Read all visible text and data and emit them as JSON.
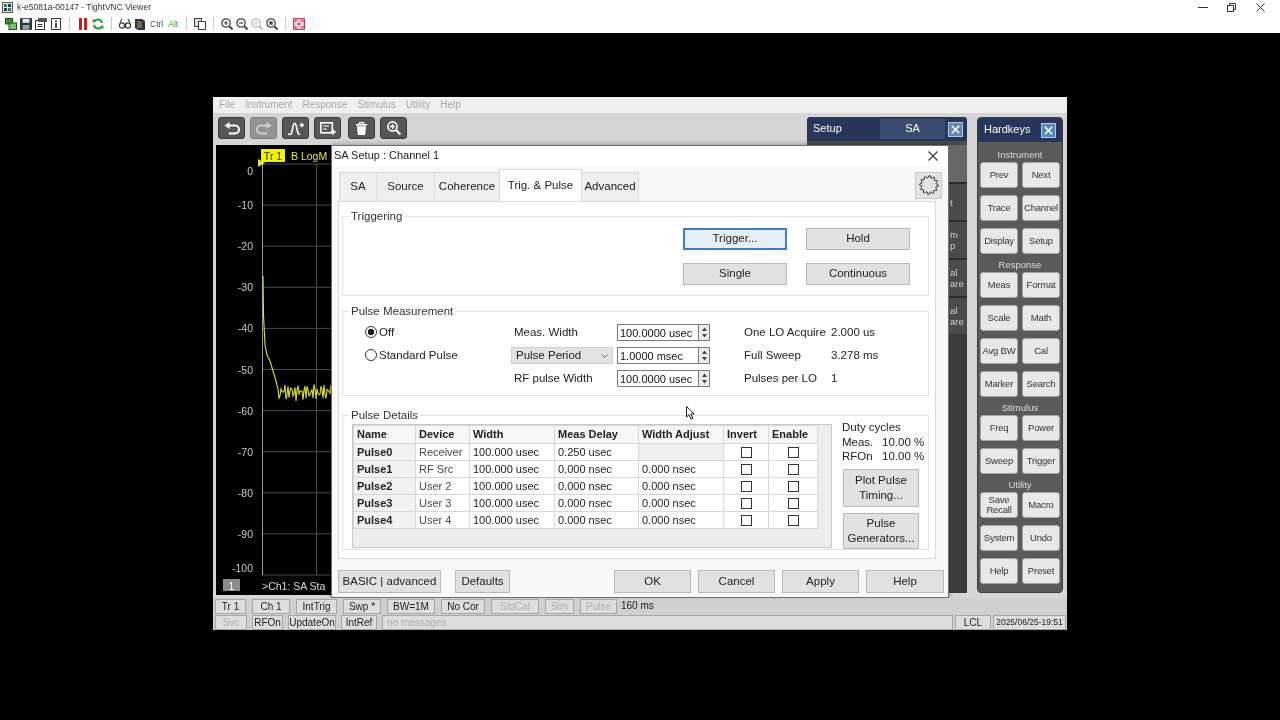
{
  "vnc_window": {
    "title": "k-e5081a-00147 - TightVNC Viewer",
    "toolbar": [
      {
        "kind": "icon",
        "disabled": false
      },
      {
        "kind": "icon",
        "disabled": false
      },
      {
        "kind": "icon",
        "disabled": false
      },
      {
        "kind": "icon",
        "disabled": false
      },
      {
        "kind": "separator"
      },
      {
        "kind": "icon",
        "disabled": false
      },
      {
        "kind": "icon",
        "disabled": false
      },
      {
        "kind": "separator"
      },
      {
        "kind": "icon",
        "disabled": false
      },
      {
        "kind": "icon",
        "disabled": false
      },
      {
        "kind": "key",
        "label": "Ctrl"
      },
      {
        "kind": "key",
        "label": "Alt"
      },
      {
        "kind": "separator"
      },
      {
        "kind": "icon",
        "disabled": false
      },
      {
        "kind": "separator"
      },
      {
        "kind": "icon",
        "disabled": false
      },
      {
        "kind": "icon",
        "disabled": false
      },
      {
        "kind": "icon",
        "disabled": true
      },
      {
        "kind": "icon",
        "disabled": false
      },
      {
        "kind": "separator"
      },
      {
        "kind": "icon",
        "disabled": false
      }
    ]
  },
  "instrument": {
    "menu": [
      {
        "label": "File",
        "disabled": true
      },
      {
        "label": "Instrument",
        "disabled": true
      },
      {
        "label": "Response",
        "disabled": true
      },
      {
        "label": "Stimulus",
        "disabled": true
      },
      {
        "label": "Utility",
        "disabled": true
      },
      {
        "label": "Help",
        "disabled": true
      }
    ],
    "toolbar": [
      {
        "disabled": false
      },
      {
        "disabled": true
      },
      {
        "disabled": false
      },
      {
        "disabled": false
      },
      {
        "disabled": false
      },
      {
        "disabled": false
      }
    ],
    "trace_window": {
      "trace_label": "Tr 1",
      "format": "B LogM",
      "y_axis_labels": [
        "0",
        "-10",
        "-20",
        "-30",
        "-40",
        "-50",
        "-60",
        "-70",
        "-80",
        "-90",
        "-100"
      ],
      "channel_number": "1",
      "channel_status": ">Ch1: SA Sta"
    },
    "setup_panel": {
      "title": "Setup",
      "tab": "SA",
      "softkeys": [
        {
          "lines": [
            "t"
          ]
        },
        {
          "lines": [
            "m",
            "p"
          ]
        },
        {
          "lines": [
            "al",
            "are"
          ]
        },
        {
          "lines": [
            "al",
            "are"
          ]
        }
      ]
    },
    "hardkeys": {
      "title": "Hardkeys",
      "sections": [
        {
          "label": "Instrument",
          "keys": [
            "Prev",
            "Next",
            "Trace",
            "Channel",
            "Display",
            "Setup"
          ]
        },
        {
          "label": "Response",
          "keys": [
            "Meas",
            "Format",
            "Scale",
            "Math",
            "Avg BW",
            "Cal",
            "Marker",
            "Search"
          ]
        },
        {
          "label": "Stimulus",
          "keys": [
            "Freq",
            "Power",
            "Sweep",
            "Trigger"
          ]
        },
        {
          "label": "Utility",
          "keys": [
            "Save Recall",
            "Macro",
            "System",
            "Undo",
            "Help",
            "Preset"
          ]
        }
      ]
    },
    "status_bar": {
      "row_1": [
        {
          "label": "Tr 1",
          "active": true
        },
        {
          "label": "Ch 1",
          "active": true
        },
        {
          "label": "IntTrig",
          "active": true
        },
        {
          "label": "Swp *",
          "active": true
        },
        {
          "label": "BW=1M",
          "active": true
        },
        {
          "label": "No Cor",
          "active": true
        },
        {
          "label": "StdCal",
          "active": false
        },
        {
          "label": "Sim",
          "active": false
        },
        {
          "label": "Pulse",
          "active": false
        }
      ],
      "sweep_time": "160 ms",
      "row_2": [
        {
          "label": "Svc",
          "active": false
        },
        {
          "label": "RFOn",
          "active": true
        },
        {
          "label": "UpdateOn",
          "active": true
        },
        {
          "label": "IntRef",
          "active": true
        }
      ],
      "message": "no messages",
      "indicators": [
        "LCL",
        "2025/06/25-19:51"
      ]
    }
  },
  "dialog": {
    "title": "SA Setup : Channel 1",
    "tabs": [
      {
        "label": "SA",
        "selected": false
      },
      {
        "label": "Source",
        "selected": false
      },
      {
        "label": "Coherence",
        "selected": false
      },
      {
        "label": "Trig. & Pulse",
        "selected": true
      },
      {
        "label": "Advanced",
        "selected": false
      }
    ],
    "triggering": {
      "title": "Triggering",
      "buttons": [
        {
          "label": "Trigger...",
          "focused": true
        },
        {
          "label": "Hold",
          "focused": false
        },
        {
          "label": "Single",
          "focused": false
        },
        {
          "label": "Continuous",
          "focused": false
        }
      ]
    },
    "pulse_measurement": {
      "title": "Pulse Measurement",
      "modes": [
        {
          "label": "Off",
          "selected": true
        },
        {
          "label": "Standard Pulse",
          "selected": false
        }
      ],
      "fields": [
        {
          "kind": "label",
          "label": "Meas. Width",
          "value": "100.0000 usec"
        },
        {
          "kind": "dropdown",
          "label": "Pulse Period",
          "value": "1.0000 msec"
        },
        {
          "kind": "label",
          "label": "RF pulse Width",
          "value": "100.0000 usec"
        }
      ],
      "readouts": [
        {
          "label": "One LO Acquire",
          "value": "2.000 us"
        },
        {
          "label": "Full Sweep",
          "value": "3.278 ms"
        },
        {
          "label": "Pulses per LO",
          "value": "1"
        }
      ]
    },
    "pulse_details": {
      "title": "Pulse Details",
      "columns": [
        "Name",
        "Device",
        "Width",
        "Meas Delay",
        "Width Adjust",
        "Invert",
        "Enable"
      ],
      "rows": [
        {
          "name": "Pulse0",
          "device": "Receiver",
          "width": "100.000 usec",
          "meas_delay": "0.250 usec",
          "editable": false,
          "invert": false,
          "enable": false
        },
        {
          "name": "Pulse1",
          "device": "RF Src",
          "width": "100.000 usec",
          "meas_delay": "0.000 nsec",
          "width_adjust": "0.000 nsec",
          "editable": true,
          "invert": false,
          "enable": false
        },
        {
          "name": "Pulse2",
          "device": "User 2",
          "width": "100.000 usec",
          "meas_delay": "0.000 nsec",
          "width_adjust": "0.000 nsec",
          "editable": true,
          "invert": false,
          "enable": false
        },
        {
          "name": "Pulse3",
          "device": "User 3",
          "width": "100.000 usec",
          "meas_delay": "0.000 nsec",
          "width_adjust": "0.000 nsec",
          "editable": true,
          "invert": false,
          "enable": false
        },
        {
          "name": "Pulse4",
          "device": "User 4",
          "width": "100.000 usec",
          "meas_delay": "0.000 nsec",
          "width_adjust": "0.000 nsec",
          "editable": true,
          "invert": false,
          "enable": false
        }
      ],
      "duty_cycles": {
        "title": "Duty cycles",
        "rows": [
          {
            "label": "Meas.",
            "value": "10.00 %"
          },
          {
            "label": "RFOn",
            "value": "10.00 %"
          }
        ]
      },
      "buttons": [
        "Plot Pulse Timing...",
        "Pulse Generators..."
      ]
    },
    "buttons_left": [
      "BASIC | advanced",
      "Defaults"
    ],
    "buttons_right": [
      "OK",
      "Cancel",
      "Apply",
      "Help"
    ]
  }
}
